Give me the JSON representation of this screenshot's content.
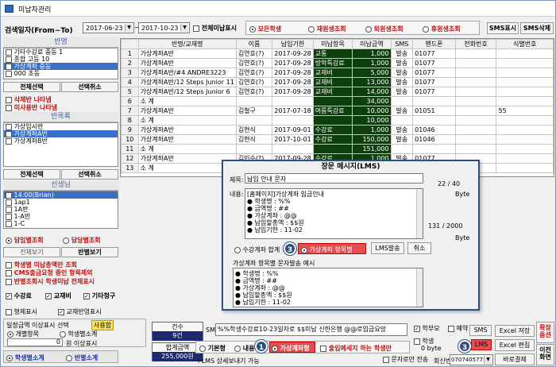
{
  "window": {
    "title": "미납자관리"
  },
  "filter": {
    "date_label": "검색일자(From~To)",
    "date_from": "2017-06-23",
    "date_sep": "~",
    "date_to": "2017-10-23",
    "show_all_unpaid": "전체미납표시",
    "student_options": [
      "모든학생",
      "재원생조회",
      "퇴원생조회",
      "휴원생조회"
    ],
    "sms_show": "SMS표시",
    "sms_delete": "SMS삭제"
  },
  "class_panel": {
    "title": "반명",
    "items": [
      "기타수강료 중등 1",
      "종합 고등 10",
      "가상계좌 중등",
      "000 초등"
    ],
    "select_all": "전체선택",
    "deselect": "선택취소",
    "deleted_class": "삭제반 나타냄",
    "unpaid_class": "미사용반 나타냄"
  },
  "sub_panel": {
    "title": "반목록",
    "items": [
      "가상입시반",
      "가상계좌A반",
      "가상계좌B반"
    ],
    "select_all": "전체선택",
    "deselect": "선택취소"
  },
  "teacher_panel": {
    "title": "선생님",
    "items": [
      "14:00(Brian)",
      "1ap1",
      "1A반",
      "1-A반",
      "1-C"
    ],
    "opt_class": "담임별조회",
    "opt_charge": "담당별조회",
    "view_all": "전체보기",
    "view_class": "반별보기"
  },
  "options": {
    "by_student": "학생별 미납총액만 조회",
    "cms_exclude": "CMS출금요청 중인 항목제외",
    "class_all": "반별조회시 학생미납 전체표시",
    "fee": "수강료",
    "material": "교재비",
    "etc": "기타청구",
    "sibling": "형제표시",
    "class_reflect": "교재반영표시"
  },
  "range": {
    "label": "일정금액 이상표시 선택",
    "use": "사용함",
    "opt_item": "개별항목",
    "opt_student": "학생별소계",
    "amount": "0",
    "amount_unit": "원 이상표시"
  },
  "summary_opts": {
    "student_subtotal": "학생별소계",
    "class_subtotal": "반별소계"
  },
  "grid": {
    "headers": [
      "반명/교재명",
      "이름",
      "납입기한",
      "미납항목",
      "미납금액",
      "SMS",
      "핸드폰",
      "전화번호",
      "식별번호"
    ],
    "rows": [
      [
        "1",
        "가상계좌A반",
        "김연호(?)",
        "2017-09-28",
        "교통",
        "1,000",
        "발송",
        "01077",
        "",
        "",
        ""
      ],
      [
        "2",
        "가상계좌A반",
        "김연호(?)",
        "2017-09-28",
        "방학특강료",
        "1,000",
        "발송",
        "01077",
        "",
        "",
        ""
      ],
      [
        "3",
        "가상계좌A반/#4 ANDRE3223",
        "김연호(?)",
        "2017-09-28",
        "교재비",
        "5,000",
        "발송",
        "01077",
        "",
        "",
        ""
      ],
      [
        "4",
        "가상계좌A반/12 Steps Junior 11",
        "김연호(?)",
        "2017-09-28",
        "교재비",
        "13,000",
        "발송",
        "01077",
        "",
        "",
        ""
      ],
      [
        "5",
        "가상계좌A반/12 Steps Junior 6",
        "김연호(?)",
        "2017-09-28",
        "교재비",
        "14,000",
        "발송",
        "01077",
        "",
        "",
        ""
      ],
      [
        "6",
        "소 계",
        "",
        "",
        "",
        "34,000",
        "",
        "",
        "",
        "",
        ""
      ],
      [
        "7",
        "가상계좌A반",
        "김철구",
        "2017-07-18",
        "여름특강료",
        "10,000",
        "발송",
        "01051",
        "",
        "55",
        "",
        ""
      ],
      [
        "8",
        "소 계",
        "",
        "",
        "",
        "10,000",
        "",
        "",
        "",
        "",
        ""
      ],
      [
        "9",
        "가상계좌A반",
        "김현식",
        "2017-09-01",
        "수강료",
        "1,000",
        "발송",
        "01046",
        "",
        "",
        ""
      ],
      [
        "10",
        "가상계좌A반",
        "김현식",
        "2017-10-01",
        "수강료",
        "150,000",
        "발송",
        "01046",
        "",
        "",
        ""
      ],
      [
        "11",
        "소 계",
        "",
        "",
        "",
        "151,000",
        "",
        "",
        "",
        "",
        ""
      ],
      [
        "12",
        "가상계좌A반",
        "김민수(?)",
        "2017-09-28",
        "수강료",
        "1,000",
        "발송",
        "01077",
        "",
        "",
        ""
      ],
      [
        "13",
        "소 계",
        "",
        "",
        "",
        "",
        "",
        "",
        "",
        "",
        ""
      ]
    ]
  },
  "lms": {
    "title": "장문 메시지(LMS)",
    "subject_label": "제목:",
    "subject": "납입 안내 문자",
    "count1": "22 / 40",
    "byte1": "Byte",
    "content_label": "내용:",
    "content_first": "[홈페이지]가상계좌 입금안내",
    "content_lines": [
      "학생명 : %%",
      "금액명 : ##",
      "가상계좌 : @@",
      "납입할총액 : $$원",
      "납입기한 : 11-02"
    ],
    "count2": "131 / 2000",
    "byte2": "Byte",
    "opt_all": "수강계좌 합계",
    "opt_item": "가상계좌 항목별",
    "send": "LMS발송",
    "cancel": "취소",
    "preview_label": "가상계좌 항목별  문자발송 예시",
    "preview_lines": [
      "학생명 : %%",
      "금액명 : ##",
      "가상계좌 : @@",
      "납입할총액 : $$원",
      "납입기한 : 11-02"
    ],
    "badge": "3"
  },
  "bottom": {
    "count_label": "건수",
    "count": "9건",
    "total_label": "합계금액",
    "total": "255,000원",
    "sms_label": "SMS",
    "sms_text": "%%학생수강료10-23일자로 $$미납 신한은행 @@로입금요망",
    "opt_basic": "기본형",
    "opt_content": "내용형",
    "opt_vaccount": "가상계좌형",
    "unpaid_only": "출입메세지 하는 학생만",
    "lms_detail": "+LMS 상세보내기 가능",
    "parent": "학부모",
    "student": "학생",
    "reserve": "예약",
    "byte": "0 byte",
    "sms_btn": "SMS",
    "lms_btn": "LMS",
    "text_only": "문자로만 전송",
    "reply_label": "회신번호",
    "reply_no": "07074057755",
    "excel_save": "Excel 저장",
    "excel_edit": "Excel 편집",
    "barcode": "바로결제",
    "confirm": "확장 옵션",
    "unpaid_screen": "이전 화면",
    "badge1": "1",
    "badge3": "3"
  }
}
